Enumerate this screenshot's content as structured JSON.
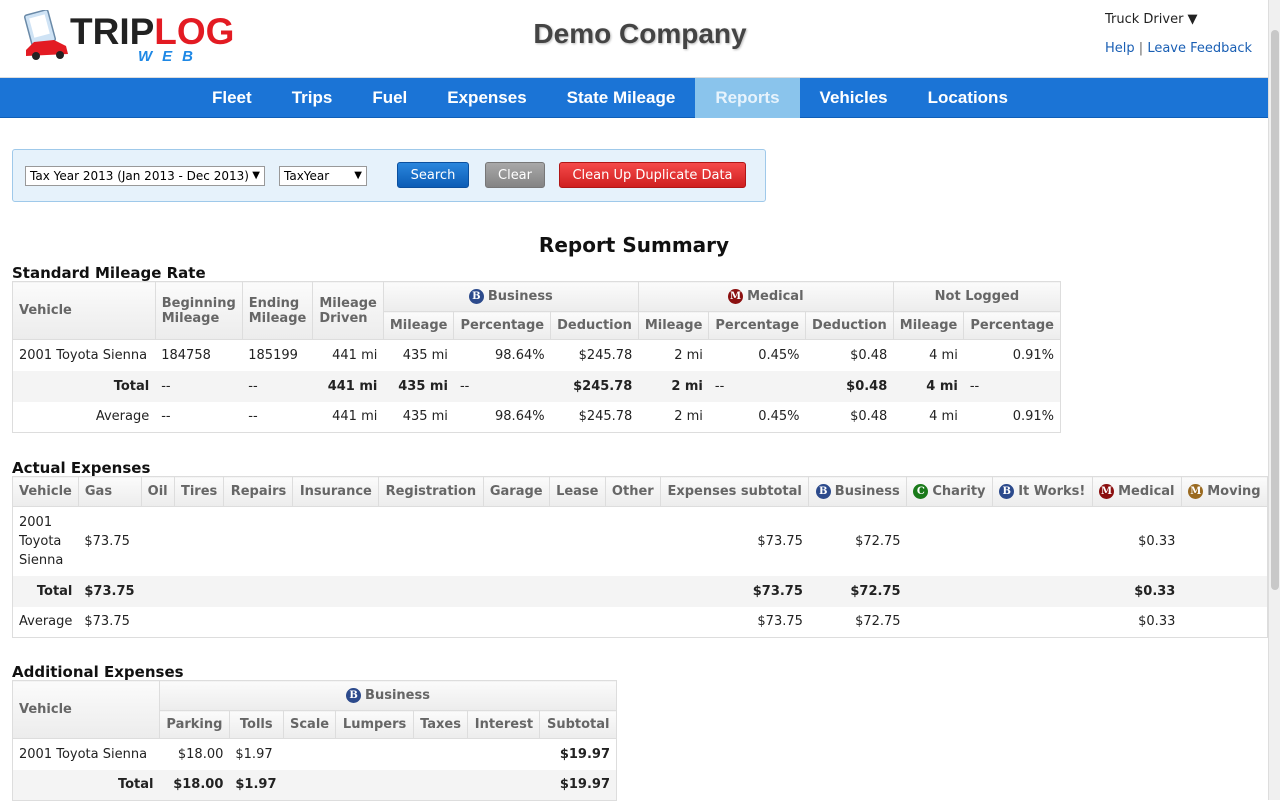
{
  "header": {
    "logo_main_1": "TRIP",
    "logo_main_2": "LOG",
    "logo_sub": "WEB",
    "company": "Demo Company",
    "user": "Truck Driver ▼",
    "help": "Help",
    "separator": "|",
    "feedback": "Leave Feedback"
  },
  "nav": [
    "Fleet",
    "Trips",
    "Fuel",
    "Expenses",
    "State Mileage",
    "Reports",
    "Vehicles",
    "Locations"
  ],
  "nav_active": "Reports",
  "filter": {
    "period": "Tax Year 2013 (Jan 2013 - Dec 2013)",
    "period_type": "TaxYear",
    "search": "Search",
    "clear": "Clear",
    "cleanup": "Clean Up Duplicate Data"
  },
  "report_title": "Report Summary",
  "standard": {
    "title": "Standard Mileage Rate",
    "h_vehicle": "Vehicle",
    "h_begin": "Beginning Mileage",
    "h_end": "Ending Mileage",
    "h_driven": "Mileage Driven",
    "g_business": "Business",
    "g_medical": "Medical",
    "g_notlogged": "Not Logged",
    "h_mileage": "Mileage",
    "h_percentage": "Percentage",
    "h_deduction": "Deduction",
    "rows": [
      [
        "2001 Toyota Sienna",
        "184758",
        "185199",
        "441 mi",
        "435 mi",
        "98.64%",
        "$245.78",
        "2 mi",
        "0.45%",
        "$0.48",
        "4 mi",
        "0.91%"
      ],
      [
        "Total",
        "--",
        "--",
        "441 mi",
        "435 mi",
        "--",
        "$245.78",
        "2 mi",
        "--",
        "$0.48",
        "4 mi",
        "--"
      ],
      [
        "Average",
        "--",
        "--",
        "441 mi",
        "435 mi",
        "98.64%",
        "$245.78",
        "2 mi",
        "0.45%",
        "$0.48",
        "4 mi",
        "0.91%"
      ]
    ]
  },
  "actual": {
    "title": "Actual Expenses",
    "headers": [
      "Vehicle",
      "Gas",
      "Oil",
      "Tires",
      "Repairs",
      "Insurance",
      "Registration",
      "Garage",
      "Lease",
      "Other",
      "Expenses subtotal",
      "Business",
      "Charity",
      "It Works!",
      "Medical",
      "Moving"
    ],
    "rows": [
      [
        "2001 Toyota Sienna",
        "$73.75",
        "",
        "",
        "",
        "",
        "",
        "",
        "",
        "",
        "$73.75",
        "$72.75",
        "",
        "",
        "$0.33",
        ""
      ],
      [
        "Total",
        "$73.75",
        "",
        "",
        "",
        "",
        "",
        "",
        "",
        "",
        "$73.75",
        "$72.75",
        "",
        "",
        "$0.33",
        ""
      ],
      [
        "Average",
        "$73.75",
        "",
        "",
        "",
        "",
        "",
        "",
        "",
        "",
        "$73.75",
        "$72.75",
        "",
        "",
        "$0.33",
        ""
      ]
    ]
  },
  "additional": {
    "title": "Additional Expenses",
    "h_vehicle": "Vehicle",
    "g_business": "Business",
    "headers": [
      "Parking",
      "Tolls",
      "Scale",
      "Lumpers",
      "Taxes",
      "Interest",
      "Subtotal"
    ],
    "rows": [
      [
        "2001 Toyota Sienna",
        "$18.00",
        "$1.97",
        "",
        "",
        "",
        "",
        "$19.97"
      ],
      [
        "Total",
        "$18.00",
        "$1.97",
        "",
        "",
        "",
        "",
        "$19.97"
      ]
    ]
  },
  "badges": {
    "business": "B",
    "medical": "M",
    "charity": "C",
    "itworks": "B",
    "moving": "M"
  },
  "colors": {
    "nav": "#1b74d6",
    "nav_active": "#8ac4ec",
    "search": "#0b5cb5",
    "cleanup": "#cf1f1f"
  }
}
